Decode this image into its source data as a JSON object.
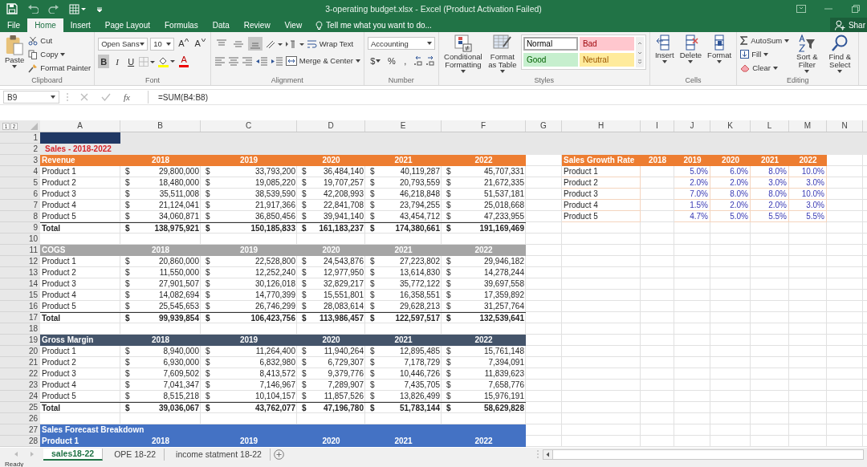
{
  "title_bar": {
    "title": "3-operating budget.xlsx - Excel (Product Activation Failed)"
  },
  "menu": {
    "tabs": [
      {
        "label": "File",
        "selected": false
      },
      {
        "label": "Home",
        "selected": true
      },
      {
        "label": "Insert",
        "selected": false
      },
      {
        "label": "Page Layout",
        "selected": false
      },
      {
        "label": "Formulas",
        "selected": false
      },
      {
        "label": "Data",
        "selected": false
      },
      {
        "label": "Review",
        "selected": false
      },
      {
        "label": "View",
        "selected": false
      }
    ],
    "tell_me": "Tell me what you want to do...",
    "share": "Shar"
  },
  "ribbon": {
    "clipboard": {
      "paste": "Paste",
      "cut": "Cut",
      "copy": "Copy",
      "format_painter": "Format Painter",
      "label": "Clipboard"
    },
    "font": {
      "name": "Open Sans",
      "size": "10",
      "grow": "A",
      "shrink": "A",
      "styles": [
        {
          "kind": "bold",
          "glyph": "B",
          "selected": true
        },
        {
          "kind": "italic",
          "glyph": "I",
          "selected": false
        },
        {
          "kind": "underline",
          "glyph": "U",
          "selected": false
        }
      ],
      "color_glyph": "A",
      "label": "Font"
    },
    "alignment": {
      "vertical": [
        {
          "kind": "top",
          "selected": false
        },
        {
          "kind": "middle",
          "selected": false
        },
        {
          "kind": "bottom",
          "selected": true
        }
      ],
      "wrap": "Wrap Text",
      "merge": "Merge & Center",
      "label": "Alignment"
    },
    "number": {
      "format": "Accounting",
      "currency": "$",
      "percent": "%",
      "comma": ",",
      "label": "Number"
    },
    "styles": {
      "conditional": "Conditional Formatting",
      "table": "Format as Table",
      "gallery": [
        {
          "name": "Normal",
          "kind": "normal",
          "color": "#ffffff",
          "selected": true
        },
        {
          "name": "Bad",
          "kind": "bad",
          "color": "#ffc7ce",
          "selected": false
        },
        {
          "name": "Good",
          "kind": "good",
          "color": "#c6efce",
          "selected": false
        },
        {
          "name": "Neutral",
          "kind": "neutral",
          "color": "#ffeb9c",
          "selected": false
        }
      ],
      "label": "Styles"
    },
    "cells": {
      "buttons": [
        {
          "kind": "insert",
          "label": "Insert"
        },
        {
          "kind": "delete",
          "label": "Delete"
        },
        {
          "kind": "format",
          "label": "Format"
        }
      ],
      "label": "Cells"
    },
    "editing": {
      "autosum": "AutoSum",
      "fill": "Fill",
      "clear": "Clear",
      "sort": "Sort & Filter",
      "find": "Find & Select",
      "label": "Editing"
    }
  },
  "formula_bar": {
    "name_box": "B9",
    "function_glyph": "fx",
    "formula": "=SUM(B4:B8)"
  },
  "sheet": {
    "outline_levels": [
      "1",
      "2"
    ],
    "columns": [
      "A",
      "B",
      "C",
      "D",
      "E",
      "F",
      "G",
      "H",
      "I",
      "J",
      "K",
      "L",
      "M",
      "N"
    ],
    "rows": [
      {
        "number": "1",
        "kind": "band",
        "color": "#203864"
      },
      {
        "number": "2",
        "kind": "band",
        "title": "Sales - 2018-2022"
      },
      {
        "number": "3",
        "kind": "header",
        "color": "#ed7d31",
        "cells": [
          "Revenue",
          "2018",
          "2019",
          "2020",
          "2021",
          "2022"
        ],
        "side": {
          "kind": "header",
          "color": "#ed7d31",
          "cells": [
            "Sales Growth Rate",
            "2018",
            "2019",
            "2020",
            "2021",
            "2022"
          ]
        }
      },
      {
        "number": "4",
        "kind": "data",
        "label": "Product 1",
        "values": [
          [
            "$",
            "29,800,000"
          ],
          [
            "$",
            "33,793,200"
          ],
          [
            "$",
            "36,484,140"
          ],
          [
            "$",
            "40,119,287"
          ],
          [
            "$",
            "45,707,331"
          ]
        ],
        "side": {
          "kind": "data",
          "label": "Product 1",
          "values": [
            "5.0%",
            "6.0%",
            "8.0%",
            "10.0%"
          ]
        }
      },
      {
        "number": "5",
        "kind": "data",
        "label": "Product 2",
        "values": [
          [
            "$",
            "18,480,000"
          ],
          [
            "$",
            "19,085,220"
          ],
          [
            "$",
            "19,707,257"
          ],
          [
            "$",
            "20,793,559"
          ],
          [
            "$",
            "21,672,335"
          ]
        ],
        "side": {
          "kind": "data",
          "label": "Product 2",
          "values": [
            "2.0%",
            "2.0%",
            "3.0%",
            "3.0%"
          ]
        }
      },
      {
        "number": "6",
        "kind": "data",
        "label": "Product 3",
        "values": [
          [
            "$",
            "35,511,008"
          ],
          [
            "$",
            "38,539,590"
          ],
          [
            "$",
            "42,208,993"
          ],
          [
            "$",
            "46,218,848"
          ],
          [
            "$",
            "51,537,181"
          ]
        ],
        "side": {
          "kind": "data",
          "label": "Product 3",
          "values": [
            "7.0%",
            "8.0%",
            "8.0%",
            "10.0%"
          ]
        }
      },
      {
        "number": "7",
        "kind": "data",
        "label": "Product 4",
        "values": [
          [
            "$",
            "21,124,041"
          ],
          [
            "$",
            "21,917,366"
          ],
          [
            "$",
            "22,841,708"
          ],
          [
            "$",
            "23,794,255"
          ],
          [
            "$",
            "25,018,668"
          ]
        ],
        "side": {
          "kind": "data",
          "label": "Product 4",
          "values": [
            "1.5%",
            "2.0%",
            "2.0%",
            "3.0%"
          ]
        }
      },
      {
        "number": "8",
        "kind": "data",
        "label": "Product 5",
        "values": [
          [
            "$",
            "34,060,871"
          ],
          [
            "$",
            "36,850,456"
          ],
          [
            "$",
            "39,941,140"
          ],
          [
            "$",
            "43,454,712"
          ],
          [
            "$",
            "47,233,955"
          ]
        ],
        "side": {
          "kind": "data",
          "label": "Product 5",
          "values": [
            "4.7%",
            "5.0%",
            "5.5%",
            "5.5%"
          ]
        }
      },
      {
        "number": "9",
        "kind": "total",
        "label": "Total",
        "values": [
          [
            "$",
            "138,975,921"
          ],
          [
            "$",
            "150,185,833"
          ],
          [
            "$",
            "161,183,237"
          ],
          [
            "$",
            "174,380,661"
          ],
          [
            "$",
            "191,169,469"
          ]
        ]
      },
      {
        "number": "10",
        "kind": "blank"
      },
      {
        "number": "11",
        "kind": "header",
        "color": "#a5a5a5",
        "cells": [
          "COGS",
          "2018",
          "2019",
          "2020",
          "2021",
          "2022"
        ]
      },
      {
        "number": "12",
        "kind": "data",
        "label": "Product 1",
        "values": [
          [
            "$",
            "20,860,000"
          ],
          [
            "$",
            "22,528,800"
          ],
          [
            "$",
            "24,543,876"
          ],
          [
            "$",
            "27,223,802"
          ],
          [
            "$",
            "29,946,182"
          ]
        ]
      },
      {
        "number": "13",
        "kind": "data",
        "label": "Product 2",
        "values": [
          [
            "$",
            "11,550,000"
          ],
          [
            "$",
            "12,252,240"
          ],
          [
            "$",
            "12,977,950"
          ],
          [
            "$",
            "13,614,830"
          ],
          [
            "$",
            "14,278,244"
          ]
        ]
      },
      {
        "number": "14",
        "kind": "data",
        "label": "Product 3",
        "values": [
          [
            "$",
            "27,901,507"
          ],
          [
            "$",
            "30,126,018"
          ],
          [
            "$",
            "32,829,217"
          ],
          [
            "$",
            "35,772,122"
          ],
          [
            "$",
            "39,697,558"
          ]
        ]
      },
      {
        "number": "15",
        "kind": "data",
        "label": "Product 4",
        "values": [
          [
            "$",
            "14,082,694"
          ],
          [
            "$",
            "14,770,399"
          ],
          [
            "$",
            "15,551,801"
          ],
          [
            "$",
            "16,358,551"
          ],
          [
            "$",
            "17,359,892"
          ]
        ]
      },
      {
        "number": "16",
        "kind": "data",
        "label": "Product 5",
        "values": [
          [
            "$",
            "25,545,653"
          ],
          [
            "$",
            "26,746,299"
          ],
          [
            "$",
            "28,083,614"
          ],
          [
            "$",
            "29,628,213"
          ],
          [
            "$",
            "31,257,764"
          ]
        ]
      },
      {
        "number": "17",
        "kind": "total",
        "label": "Total",
        "values": [
          [
            "$",
            "99,939,854"
          ],
          [
            "$",
            "106,423,756"
          ],
          [
            "$",
            "113,986,457"
          ],
          [
            "$",
            "122,597,517"
          ],
          [
            "$",
            "132,539,641"
          ]
        ]
      },
      {
        "number": "18",
        "kind": "blank"
      },
      {
        "number": "19",
        "kind": "header",
        "color": "#44546a",
        "cells": [
          "Gross Margin",
          "2018",
          "2019",
          "2020",
          "2021",
          "2022"
        ]
      },
      {
        "number": "20",
        "kind": "data",
        "label": "Product 1",
        "values": [
          [
            "$",
            "8,940,000"
          ],
          [
            "$",
            "11,264,400"
          ],
          [
            "$",
            "11,940,264"
          ],
          [
            "$",
            "12,895,485"
          ],
          [
            "$",
            "15,761,148"
          ]
        ]
      },
      {
        "number": "21",
        "kind": "data",
        "label": "Product 2",
        "values": [
          [
            "$",
            "6,930,000"
          ],
          [
            "$",
            "6,832,980"
          ],
          [
            "$",
            "6,729,307"
          ],
          [
            "$",
            "7,178,729"
          ],
          [
            "$",
            "7,394,091"
          ]
        ]
      },
      {
        "number": "22",
        "kind": "data",
        "label": "Product 3",
        "values": [
          [
            "$",
            "7,609,502"
          ],
          [
            "$",
            "8,413,572"
          ],
          [
            "$",
            "9,379,776"
          ],
          [
            "$",
            "10,446,726"
          ],
          [
            "$",
            "11,839,623"
          ]
        ]
      },
      {
        "number": "23",
        "kind": "data",
        "label": "Product 4",
        "values": [
          [
            "$",
            "7,041,347"
          ],
          [
            "$",
            "7,146,967"
          ],
          [
            "$",
            "7,289,907"
          ],
          [
            "$",
            "7,435,705"
          ],
          [
            "$",
            "7,658,776"
          ]
        ]
      },
      {
        "number": "24",
        "kind": "data",
        "label": "Product 5",
        "values": [
          [
            "$",
            "8,515,218"
          ],
          [
            "$",
            "10,104,157"
          ],
          [
            "$",
            "11,857,526"
          ],
          [
            "$",
            "13,826,499"
          ],
          [
            "$",
            "15,976,191"
          ]
        ]
      },
      {
        "number": "25",
        "kind": "total",
        "label": "Total",
        "values": [
          [
            "$",
            "39,036,067"
          ],
          [
            "$",
            "43,762,077"
          ],
          [
            "$",
            "47,196,780"
          ],
          [
            "$",
            "51,783,144"
          ],
          [
            "$",
            "58,629,828"
          ]
        ]
      },
      {
        "number": "26",
        "kind": "blank"
      },
      {
        "number": "27",
        "kind": "header",
        "color": "#4472c4",
        "cells": [
          "Sales Forecast Breakdown"
        ]
      },
      {
        "number": "28",
        "kind": "header",
        "color": "#4472c4",
        "cells": [
          "Product 1",
          "2018",
          "2019",
          "2020",
          "2021",
          "2022"
        ]
      }
    ]
  },
  "sheet_tabs": [
    {
      "label": "sales18-22",
      "selected": true
    },
    {
      "label": "OPE 18-22",
      "selected": false
    },
    {
      "label": "income statment 18-22",
      "selected": false
    }
  ],
  "status_bar": {
    "text": "Ready"
  }
}
